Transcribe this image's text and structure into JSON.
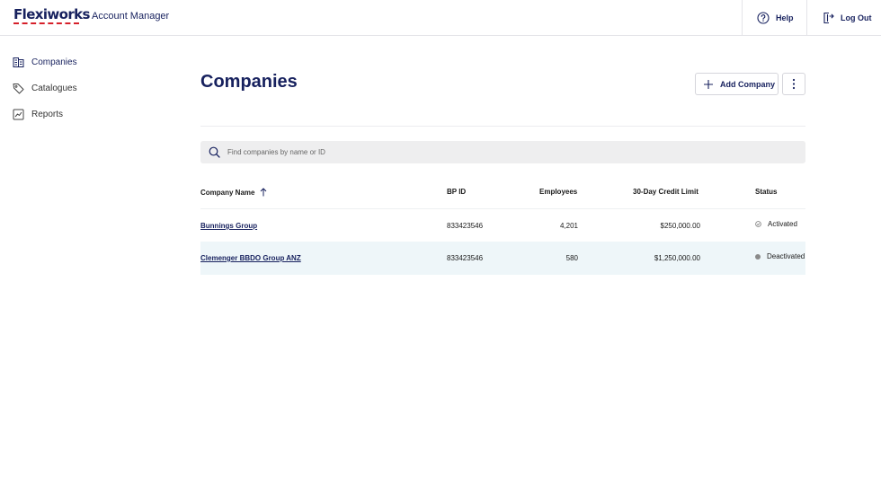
{
  "header": {
    "logo": "Flexiworks",
    "app_title": "Account Manager",
    "help_label": "Help",
    "logout_label": "Log Out"
  },
  "sidebar": {
    "items": [
      {
        "label": "Companies",
        "icon": "building-icon",
        "active": true
      },
      {
        "label": "Catalogues",
        "icon": "tag-icon",
        "active": false
      },
      {
        "label": "Reports",
        "icon": "chart-icon",
        "active": false
      }
    ]
  },
  "main": {
    "title": "Companies",
    "add_button_label": "Add Company",
    "search_placeholder": "Find companies by name or ID",
    "table": {
      "columns": [
        "Company Name",
        "BP ID",
        "Employees",
        "30-Day Credit Limit",
        "Status"
      ],
      "sort_column": "Company Name",
      "sort_direction": "ascending",
      "rows": [
        {
          "name": "Bunnings Group",
          "bp_id": "833423546",
          "employees": "4,201",
          "credit_limit": "$250,000.00",
          "status": "Activated"
        },
        {
          "name": "Clemenger BBDO Group ANZ",
          "bp_id": "833423546",
          "employees": "580",
          "credit_limit": "$1,250,000.00",
          "status": "Deactivated"
        }
      ]
    }
  },
  "colors": {
    "brand_navy": "#17215e",
    "brand_red": "#d6202a",
    "row_highlight": "#eef6f9",
    "status_grey": "#888888"
  }
}
